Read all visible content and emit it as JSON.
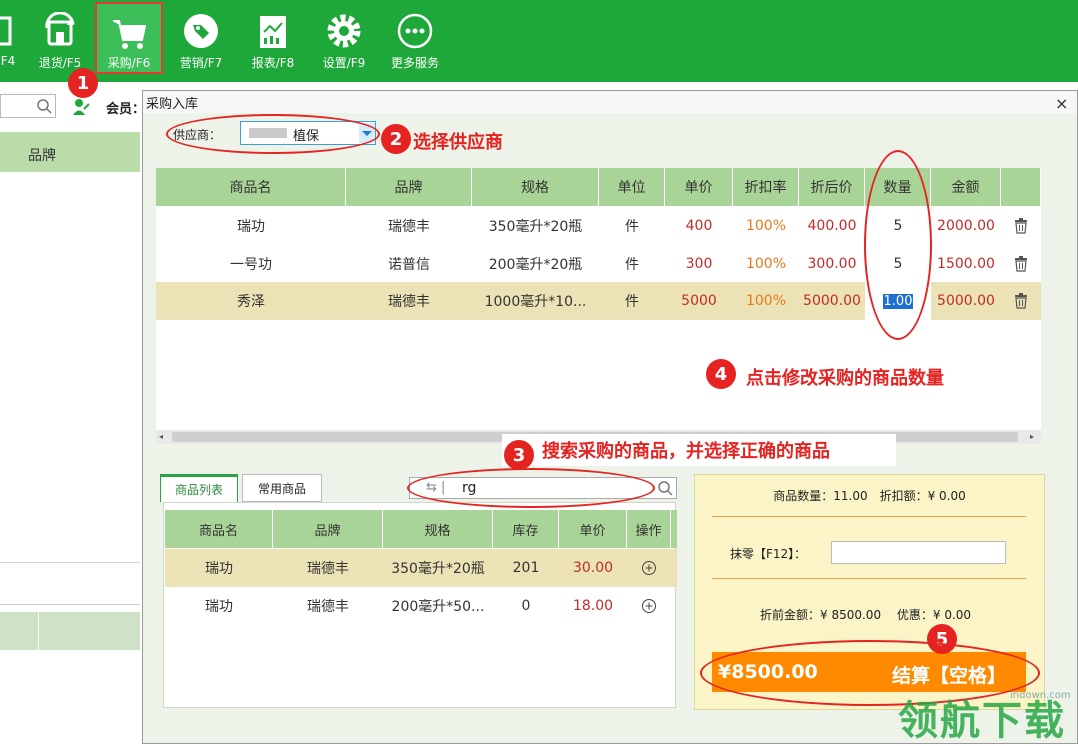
{
  "toolbar": {
    "items": [
      {
        "label": "F4",
        "icon": "partial-icon"
      },
      {
        "label": "退货/F5",
        "icon": "return-icon"
      },
      {
        "label": "采购/F6",
        "icon": "cart-icon"
      },
      {
        "label": "营销/F7",
        "icon": "tag-icon"
      },
      {
        "label": "报表/F8",
        "icon": "report-icon"
      },
      {
        "label": "设置/F9",
        "icon": "gear-icon"
      },
      {
        "label": "更多服务",
        "icon": "more-icon"
      }
    ]
  },
  "left": {
    "member_label": "会员：",
    "brand_header": "品牌"
  },
  "dialog": {
    "title": "采购入库",
    "close": "×",
    "supplier_label": "供应商：",
    "supplier_value": "植保",
    "columns": [
      "商品名",
      "品牌",
      "规格",
      "单位",
      "单价",
      "折扣率",
      "折后价",
      "数量",
      "金额"
    ],
    "rows": [
      {
        "name": "瑞功",
        "brand": "瑞德丰",
        "spec": "350毫升*20瓶",
        "unit": "件",
        "price": "400",
        "discount": "100%",
        "after": "400.00",
        "qty": "5",
        "amount": "2000.00"
      },
      {
        "name": "一号功",
        "brand": "诺普信",
        "spec": "200毫升*20瓶",
        "unit": "件",
        "price": "300",
        "discount": "100%",
        "after": "300.00",
        "qty": "5",
        "amount": "1500.00"
      },
      {
        "name": "秀泽",
        "brand": "瑞德丰",
        "spec": "1000毫升*10...",
        "unit": "件",
        "price": "5000",
        "discount": "100%",
        "after": "5000.00",
        "qty": "1.00",
        "amount": "5000.00"
      }
    ],
    "tabs": [
      "商品列表",
      "常用商品"
    ],
    "search_value": "rg",
    "search_prefix": "⇆ |",
    "product_columns": [
      "商品名",
      "品牌",
      "规格",
      "库存",
      "单价",
      "操作"
    ],
    "product_rows": [
      {
        "name": "瑞功",
        "brand": "瑞德丰",
        "spec": "350毫升*20瓶",
        "stock": "201",
        "price": "30.00"
      },
      {
        "name": "瑞功",
        "brand": "瑞德丰",
        "spec": "200毫升*50...",
        "stock": "0",
        "price": "18.00"
      }
    ],
    "summary": {
      "count_text": "商品数量：11.00　折扣额：¥ 0.00",
      "round_label": "抹零【F12】：",
      "before_text": "折前金额：¥ 8500.00　 优惠：¥ 0.00",
      "total": "¥8500.00",
      "checkout": "结算【空格】"
    }
  },
  "annotations": {
    "step1": "1",
    "step2": "2",
    "step2_text": "选择供应商",
    "step3": "3",
    "step3_text": "搜索采购的商品，并选择正确的商品",
    "step4": "4",
    "step4_text": "点击修改采购的商品数量",
    "step5": "5"
  },
  "watermark": {
    "text": "领航下载",
    "url": "lhdown.com"
  },
  "colors": {
    "toolbar": "#1fa83a",
    "header": "#a9d497",
    "highlight_row": "#ebe3b5",
    "checkout": "#ff8a00",
    "annotation": "#e52421"
  }
}
